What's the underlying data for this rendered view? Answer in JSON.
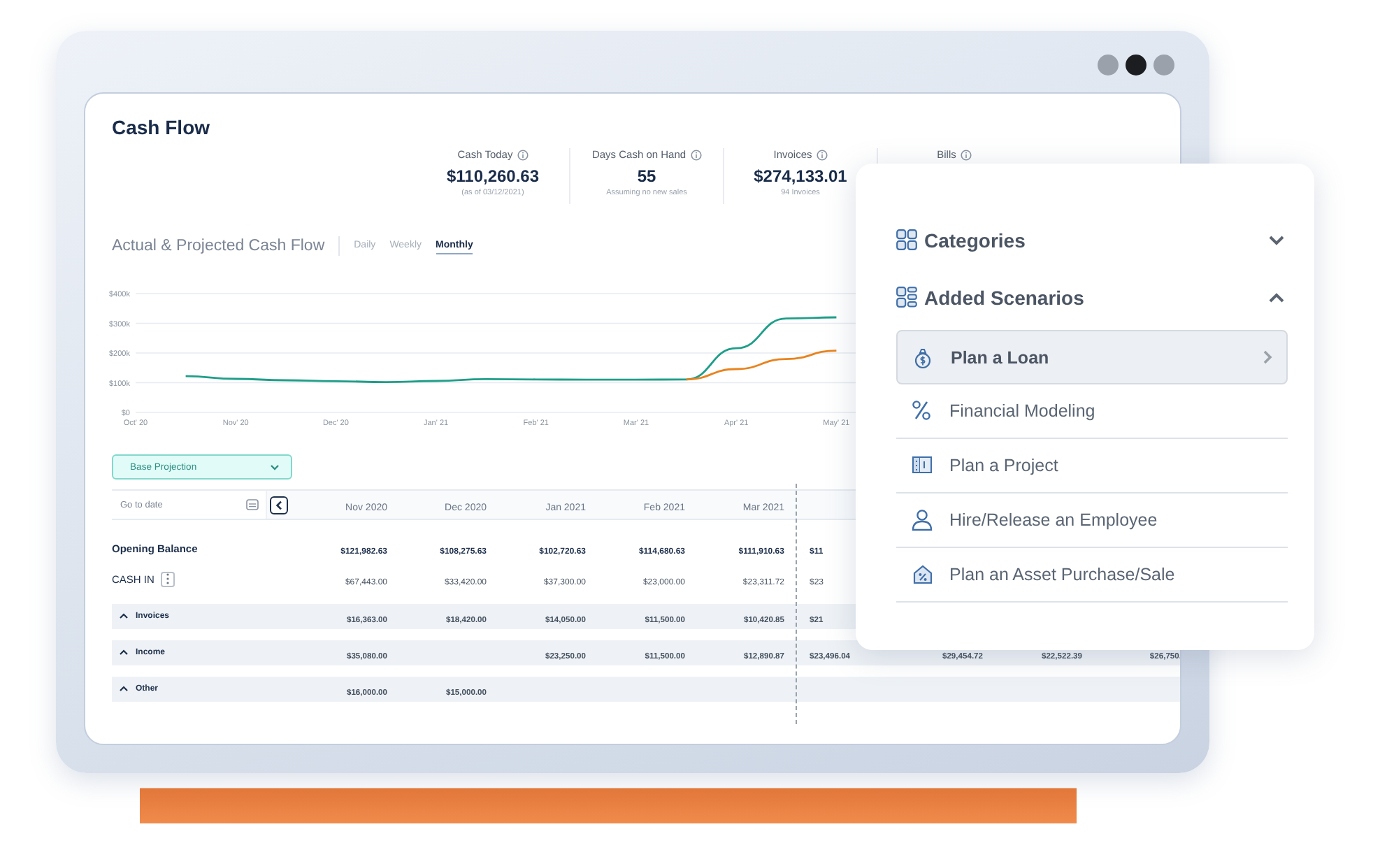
{
  "dashboard": {
    "title": "Cash Flow",
    "kpis": [
      {
        "label": "Cash Today",
        "value": "$110,260.63",
        "note": "(as of 03/12/2021)"
      },
      {
        "label": "Days Cash on Hand",
        "value": "55",
        "note": "Assuming no new sales"
      },
      {
        "label": "Invoices",
        "value": "$274,133.01",
        "note": "94 Invoices"
      },
      {
        "label": "Bills"
      }
    ],
    "chart": {
      "title": "Actual & Projected Cash Flow",
      "tabs": [
        {
          "label": "Daily",
          "selected": false
        },
        {
          "label": "Weekly",
          "selected": false
        },
        {
          "label": "Monthly",
          "selected": true
        }
      ],
      "chart_data": {
        "type": "line",
        "grid": true,
        "categories": [
          "Oct' 20",
          null,
          "Nov' 20",
          null,
          "Dec' 20",
          null,
          "Jan' 21",
          null,
          "Feb' 21",
          null,
          "Mar' 21",
          null,
          "Apr' 21",
          null,
          "May' 21"
        ],
        "ylim": [
          0,
          400000
        ],
        "yticks": [
          {
            "value": 0,
            "label": "$0"
          },
          {
            "value": 100000,
            "label": "$100k"
          },
          {
            "value": 200000,
            "label": "$200k"
          },
          {
            "value": 300000,
            "label": "$300k"
          },
          {
            "value": 400000,
            "label": "$400k"
          }
        ],
        "series": [
          {
            "color": "#1f9e89",
            "values": [
              null,
              122000,
              113000,
              108000,
              105000,
              102000,
              106000,
              112000,
              111000,
              110000,
              110000,
              111000,
              216000,
              316000,
              320000
            ]
          },
          {
            "color": "#e8831e",
            "values": [
              null,
              null,
              null,
              null,
              null,
              null,
              null,
              null,
              null,
              null,
              null,
              111000,
              146000,
              180000,
              208000
            ]
          }
        ]
      }
    },
    "scenario_select": {
      "value": "Base Projection"
    },
    "table": {
      "date_field": {
        "placeholder": "Go to date"
      },
      "columns": [
        "Nov 2020",
        "Dec 2020",
        "Jan 2021",
        "Feb 2021",
        "Mar 2021"
      ],
      "rows": [
        {
          "label": "Opening Balance",
          "kind": "balance",
          "cells": [
            "$121,982.63",
            "$108,275.63",
            "$102,720.63",
            "$114,680.63",
            "$111,910.63",
            "$11"
          ]
        },
        {
          "label": "CASH IN",
          "kind": "section",
          "cells": [
            "$67,443.00",
            "$33,420.00",
            "$37,300.00",
            "$23,000.00",
            "$23,311.72",
            "$23"
          ]
        },
        {
          "label": "Invoices",
          "kind": "group",
          "expanded": true,
          "cells": [
            "$16,363.00",
            "$18,420.00",
            "$14,050.00",
            "$11,500.00",
            "$10,420.85",
            "$21"
          ]
        },
        {
          "label": "Income",
          "kind": "group",
          "expanded": true,
          "cells": [
            "$35,080.00",
            null,
            "$23,250.00",
            "$11,500.00",
            "$12,890.87",
            "$23,496.04",
            "$29,454.72",
            "$22,522.39",
            "$26,750."
          ]
        },
        {
          "label": "Other",
          "kind": "group",
          "expanded": true,
          "cells": [
            "$16,000.00",
            "$15,000.00"
          ]
        }
      ]
    }
  },
  "scenario_panel": {
    "sections": [
      {
        "title": "Categories",
        "expanded": false
      },
      {
        "title": "Added Scenarios",
        "expanded": true,
        "items": [
          {
            "label": "Plan a Loan",
            "selected": true
          },
          {
            "label": "Financial Modeling",
            "selected": false
          },
          {
            "label": "Plan a Project",
            "selected": false
          },
          {
            "label": "Hire/Release an Employee",
            "selected": false
          },
          {
            "label": "Plan an Asset Purchase/Sale",
            "selected": false
          }
        ]
      }
    ]
  }
}
